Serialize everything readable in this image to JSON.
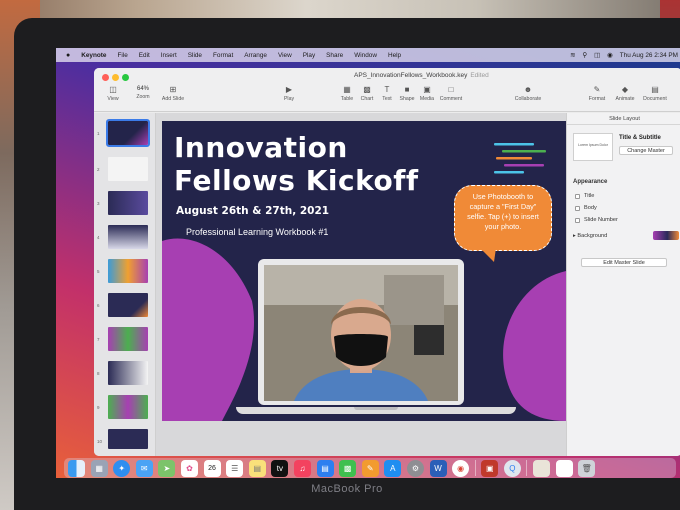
{
  "menubar": {
    "app_name": "Keynote",
    "items": [
      "File",
      "Edit",
      "Insert",
      "Slide",
      "Format",
      "Arrange",
      "View",
      "Play",
      "Share",
      "Window",
      "Help"
    ],
    "clock": "Thu Aug 26  2:34 PM"
  },
  "window": {
    "doc_title": "APS_InnovationFellows_Workbook.key",
    "doc_status": "Edited",
    "toolbar": {
      "view": "View",
      "zoom_value": "64%",
      "zoom": "Zoom",
      "add_slide": "Add Slide",
      "play": "Play",
      "table": "Table",
      "chart": "Chart",
      "text": "Text",
      "shape": "Shape",
      "media": "Media",
      "comment": "Comment",
      "collaborate": "Collaborate",
      "format": "Format",
      "animate": "Animate",
      "document": "Document"
    }
  },
  "navigator": {
    "slide_numbers": [
      "1",
      "2",
      "3",
      "4",
      "5",
      "6",
      "7",
      "8",
      "9",
      "10"
    ]
  },
  "slide": {
    "title": "Innovation Fellows Kickoff",
    "date": "August 26th & 27th, 2021",
    "subtitle": "Professional Learning Workbook #1",
    "bubble_text": "Use Photobooth to capture a \"First Day\" selfie. Tap (+) to insert your photo."
  },
  "inspector": {
    "header": "Slide Layout",
    "layout_name": "Title & Subtitle",
    "layout_thumb_text": "Lorem Ipsum Dolor",
    "change_master": "Change Master",
    "appearance": "Appearance",
    "checkboxes": [
      "Title",
      "Body",
      "Slide Number"
    ],
    "background": "Background",
    "edit_master": "Edit Master Slide"
  },
  "dock": {
    "calendar_day": "26",
    "apps": [
      "finder-icon",
      "launchpad-icon",
      "safari-icon",
      "mail-icon",
      "maps-icon",
      "photos-icon",
      "calendar-icon",
      "reminders-icon",
      "notes-icon",
      "apple-tv-icon",
      "music-icon",
      "keynote-icon",
      "numbers-icon",
      "pages-icon",
      "app-store-icon",
      "system-preferences-icon",
      "word-icon",
      "chrome-icon"
    ]
  },
  "laptop": {
    "brand": "MacBook Pro"
  },
  "colors": {
    "slide_bg": "#23244a",
    "slide_magenta": "#a73fb2",
    "bubble_orange": "#f08a37",
    "selection_blue": "#3b7be8"
  }
}
